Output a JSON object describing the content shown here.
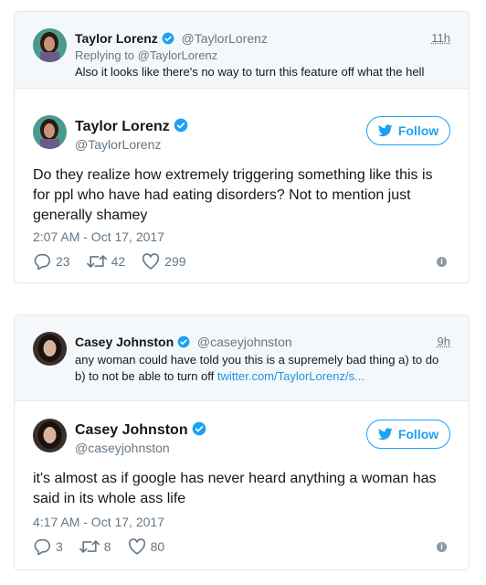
{
  "tweets": [
    {
      "parent": {
        "name": "Taylor Lorenz",
        "handle": "@TaylorLorenz",
        "time": "11h",
        "reply_to": "Replying to @TaylorLorenz",
        "text": "Also it looks like there's no way to turn this feature off what the hell"
      },
      "main": {
        "name": "Taylor Lorenz",
        "handle": "@TaylorLorenz",
        "follow_label": "Follow",
        "text": "Do they realize how extremely triggering something like this is for ppl who have had eating disorders? Not to mention just generally shamey",
        "date": "2:07 AM - Oct 17, 2017",
        "replies": "23",
        "retweets": "42",
        "likes": "299"
      }
    },
    {
      "parent": {
        "name": "Casey Johnston",
        "handle": "@caseyjohnston",
        "time": "9h",
        "text": "any woman could have told you this is a supremely bad thing a) to do b) to not be able to turn off ",
        "link": "twitter.com/TaylorLorenz/s..."
      },
      "main": {
        "name": "Casey Johnston",
        "handle": "@caseyjohnston",
        "follow_label": "Follow",
        "text": "it's almost as if google has never heard anything a woman has said in its whole ass life",
        "date": "4:17 AM - Oct 17, 2017",
        "replies": "3",
        "retweets": "8",
        "likes": "80"
      }
    }
  ],
  "colors": {
    "accent": "#1da1f2",
    "muted": "#657786",
    "border": "#e1e8ed",
    "bg_parent": "#f5f8fa"
  },
  "icons": [
    "verified-badge-icon",
    "twitter-bird-icon",
    "reply-icon",
    "retweet-icon",
    "like-icon",
    "info-icon"
  ]
}
